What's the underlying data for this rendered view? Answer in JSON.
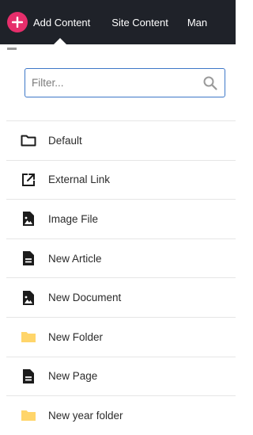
{
  "topbar": {
    "add_content_label": "Add Content",
    "nav": [
      "Site Content",
      "Man"
    ]
  },
  "filter": {
    "placeholder": "Filter...",
    "value": ""
  },
  "items": [
    {
      "label": "Default",
      "icon": "folder-outline-icon"
    },
    {
      "label": "External Link",
      "icon": "external-link-icon"
    },
    {
      "label": "Image File",
      "icon": "image-file-icon"
    },
    {
      "label": "New Article",
      "icon": "document-icon"
    },
    {
      "label": "New Document",
      "icon": "image-file-icon"
    },
    {
      "label": "New Folder",
      "icon": "folder-filled-icon"
    },
    {
      "label": "New Page",
      "icon": "document-icon"
    },
    {
      "label": "New year folder",
      "icon": "folder-filled-icon"
    }
  ],
  "colors": {
    "topbar_bg": "#1f2229",
    "accent_pink": "#e62e6b",
    "input_border": "#3d77c8",
    "folder_yellow": "#ffd56a"
  }
}
